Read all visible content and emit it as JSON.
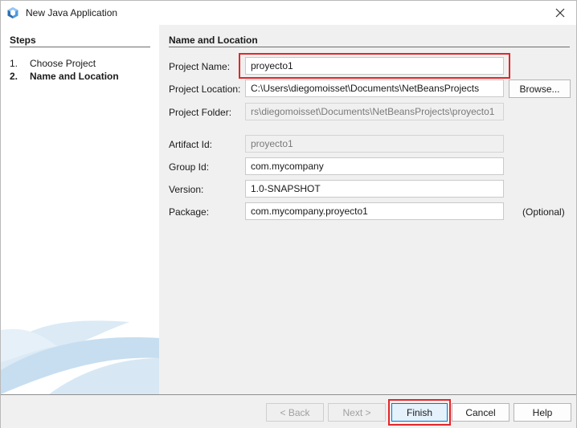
{
  "window": {
    "title": "New Java Application",
    "icon": "netbeans-cube-icon",
    "close_icon": "close-icon"
  },
  "steps": {
    "title": "Steps",
    "items": [
      {
        "num": "1.",
        "label": "Choose Project"
      },
      {
        "num": "2.",
        "label": "Name and Location"
      }
    ]
  },
  "main": {
    "section_title": "Name and Location",
    "fields": {
      "project_name": {
        "label": "Project Name:",
        "value": "proyecto1"
      },
      "project_location": {
        "label": "Project Location:",
        "value": "C:\\Users\\diegomoisset\\Documents\\NetBeansProjects"
      },
      "project_folder": {
        "label": "Project Folder:",
        "value": "rs\\diegomoisset\\Documents\\NetBeansProjects\\proyecto1"
      },
      "artifact_id": {
        "label": "Artifact Id:",
        "value": "proyecto1"
      },
      "group_id": {
        "label": "Group Id:",
        "value": "com.mycompany"
      },
      "version": {
        "label": "Version:",
        "value": "1.0-SNAPSHOT"
      },
      "package": {
        "label": "Package:",
        "value": "com.mycompany.proyecto1",
        "hint": "(Optional)"
      }
    },
    "browse_label": "Browse..."
  },
  "buttons": {
    "back": "< Back",
    "next": "Next >",
    "finish": "Finish",
    "cancel": "Cancel",
    "help": "Help"
  },
  "colors": {
    "highlight": "#e1262c",
    "accent": "#0078d7"
  }
}
